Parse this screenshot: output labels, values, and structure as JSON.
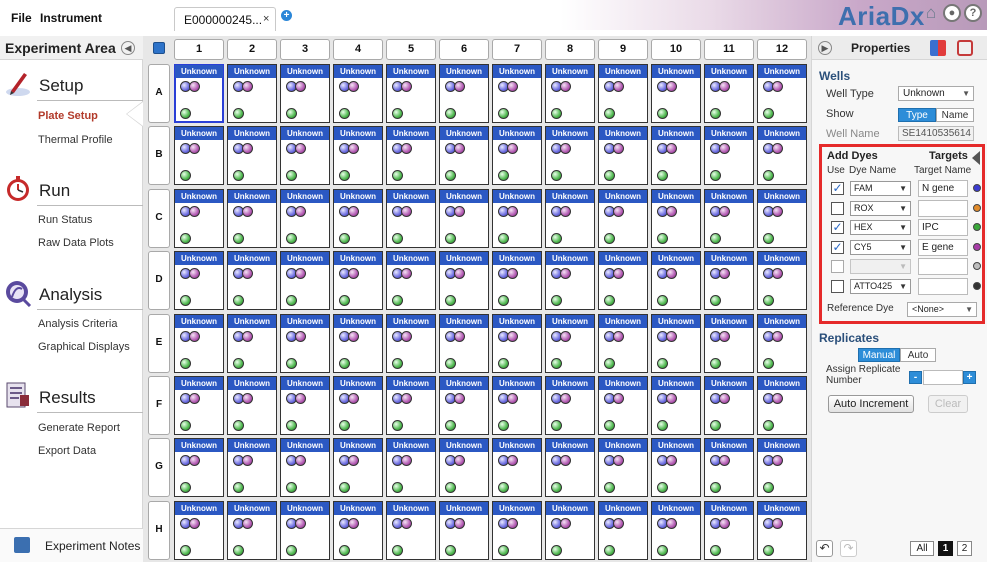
{
  "menu": {
    "file": "File",
    "instrument": "Instrument"
  },
  "tab": {
    "title": "E000000245...",
    "close": "×",
    "add": "+"
  },
  "brand": {
    "logo": "AriaDx"
  },
  "left": {
    "title": "Experiment Area",
    "sections": [
      {
        "title": "Setup",
        "icon": "setup-pen-icon",
        "items": [
          "Plate Setup",
          "Thermal Profile"
        ]
      },
      {
        "title": "Run",
        "icon": "run-stopwatch-icon",
        "items": [
          "Run Status",
          "Raw Data Plots"
        ]
      },
      {
        "title": "Analysis",
        "icon": "analysis-magnifier-icon",
        "items": [
          "Analysis Criteria",
          "Graphical Displays"
        ]
      },
      {
        "title": "Results",
        "icon": "results-report-icon",
        "items": [
          "Generate Report",
          "Export Data"
        ]
      }
    ],
    "notes": "Experiment Notes"
  },
  "plate": {
    "columns": [
      "1",
      "2",
      "3",
      "4",
      "5",
      "6",
      "7",
      "8",
      "9",
      "10",
      "11",
      "12"
    ],
    "rows": [
      "A",
      "B",
      "C",
      "D",
      "E",
      "F",
      "G",
      "H"
    ],
    "well_type_label": "Unknown",
    "selected_well": "A1",
    "well_dyes": [
      "blue",
      "purple",
      "green"
    ]
  },
  "properties": {
    "title": "Properties",
    "wells_heading": "Wells",
    "well_type_label": "Well Type",
    "well_type_value": "Unknown",
    "show_label": "Show",
    "show_options": [
      "Type",
      "Name"
    ],
    "show_selected": "Type",
    "well_name_label": "Well Name",
    "well_name_value": "SE1410535614",
    "add_dyes": "Add Dyes",
    "targets": "Targets",
    "use_header": "Use",
    "dye_name_header": "Dye Name",
    "target_name_header": "Target Name",
    "dyes": [
      {
        "use": true,
        "dye": "FAM",
        "target": "N gene",
        "color": "#3b3bd1",
        "enabled": true
      },
      {
        "use": false,
        "dye": "ROX",
        "target": "",
        "color": "#e08a2a",
        "enabled": true
      },
      {
        "use": true,
        "dye": "HEX",
        "target": "IPC",
        "color": "#3aa83a",
        "enabled": true
      },
      {
        "use": true,
        "dye": "CY5",
        "target": "E gene",
        "color": "#a83ca8",
        "enabled": true
      },
      {
        "use": false,
        "dye": "",
        "target": "",
        "color": "#bdbdbd",
        "enabled": false
      },
      {
        "use": false,
        "dye": "ATTO425",
        "target": "",
        "color": "#333333",
        "enabled": true
      }
    ],
    "reference_dye_label": "Reference Dye",
    "reference_dye_value": "<None>",
    "replicates_heading": "Replicates",
    "replicate_modes": [
      "Manual",
      "Auto"
    ],
    "replicate_selected": "Manual",
    "assign_replicate": "Assign Replicate Number",
    "auto_increment": "Auto Increment",
    "clear": "Clear",
    "pages": [
      "All",
      "1",
      "2"
    ],
    "page_selected": "1"
  }
}
